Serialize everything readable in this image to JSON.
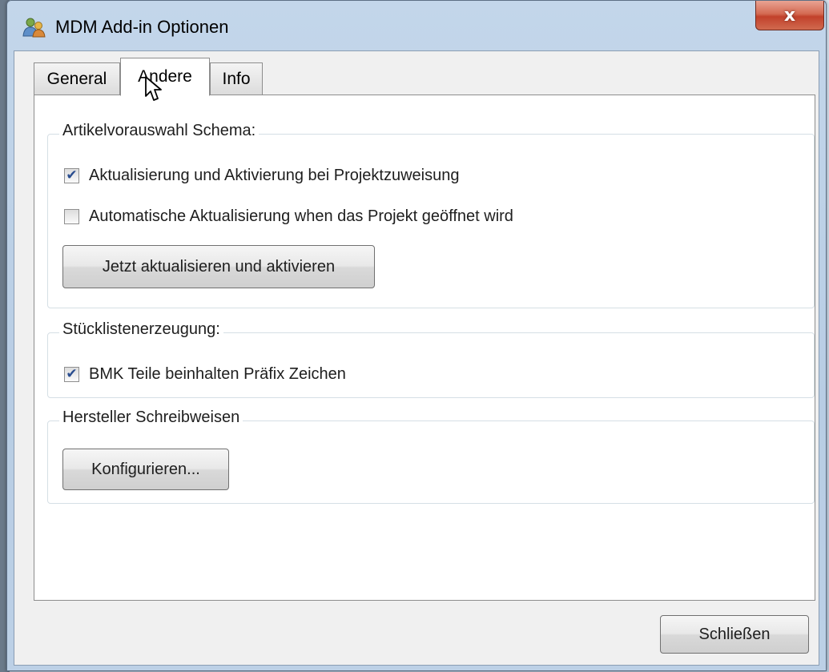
{
  "window": {
    "title": "MDM Add-in Optionen",
    "close_label": "x",
    "app_icon": "users-icon"
  },
  "tabs": [
    {
      "label": "General",
      "active": false
    },
    {
      "label": "Andere",
      "active": true
    },
    {
      "label": "Info",
      "active": false
    }
  ],
  "groups": {
    "schema": {
      "legend": "Artikelvorauswahl Schema:",
      "options": [
        {
          "label": "Aktualisierung und Aktivierung bei Projektzuweisung",
          "checked": true
        },
        {
          "label": "Automatische Aktualisierung when das Projekt geöffnet wird",
          "checked": false
        }
      ],
      "button_label": "Jetzt aktualisieren und aktivieren"
    },
    "bom": {
      "legend": "Stücklistenerzeugung:",
      "options": [
        {
          "label": "BMK Teile beinhalten Präfix Zeichen",
          "checked": true
        }
      ]
    },
    "manufacturer": {
      "legend": "Hersteller Schreibweisen",
      "button_label": "Konfigurieren..."
    }
  },
  "footer": {
    "close_label": "Schließen"
  }
}
